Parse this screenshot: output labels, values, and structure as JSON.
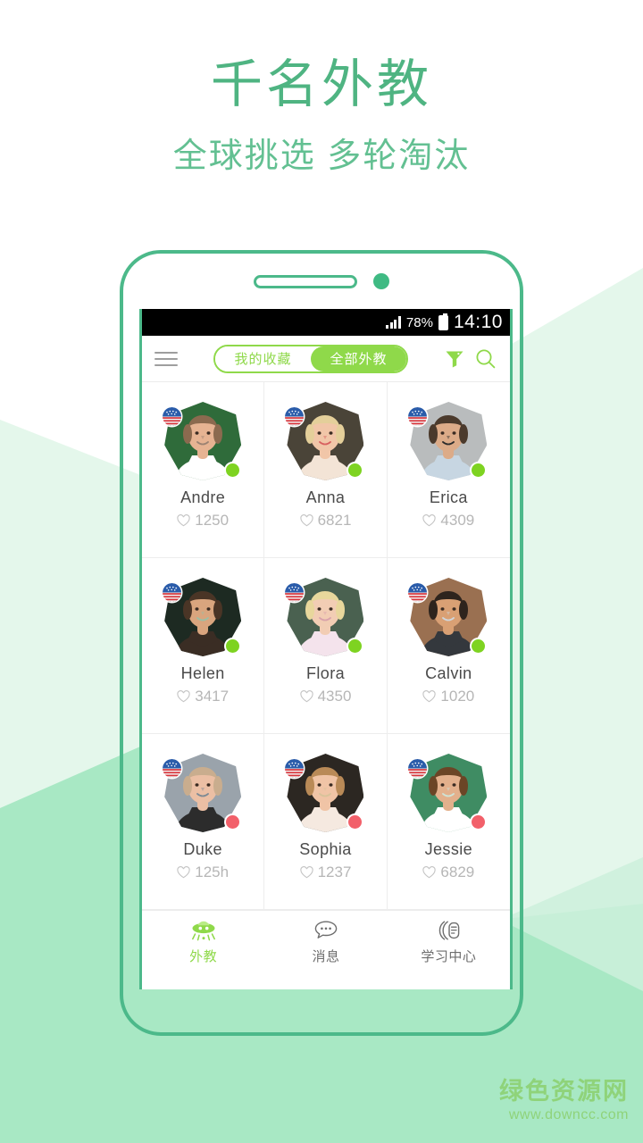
{
  "promo": {
    "title": "千名外教",
    "subtitle": "全球挑选 多轮淘汰",
    "title_color": "#4fb482",
    "subtitle_color": "#63c092"
  },
  "device": {
    "frame_color": "#4cb98a",
    "speaker": "speaker-slot",
    "camera": "front-camera",
    "home_button": "home-button"
  },
  "statusbar": {
    "signal": "signal-bars",
    "battery_percent": "78%",
    "battery": "battery-icon",
    "time": "14:10"
  },
  "appbar": {
    "menu": "hamburger-menu",
    "segment": {
      "left_label": "我的收藏",
      "right_label": "全部外教",
      "selected": "全部外教"
    },
    "filter": "filter-funnel-icon",
    "search": "search-icon",
    "accent": "#8fd94a"
  },
  "teachers": [
    {
      "name": "Andre",
      "likes": "1250",
      "status": "online",
      "flag": "us-flag",
      "bg": "#2f6b3a",
      "skin": "#e6b392",
      "hair": "#8b6a4f",
      "cloth": "#ffffff",
      "accent": "#9b8272"
    },
    {
      "name": "Anna",
      "likes": "6821",
      "status": "online",
      "flag": "us-flag",
      "bg": "#4a4438",
      "skin": "#f1c6a8",
      "hair": "#e4cf9a",
      "cloth": "#f3e4d6",
      "accent": "#d8605f"
    },
    {
      "name": "Erica",
      "likes": "4309",
      "status": "online",
      "flag": "us-flag",
      "bg": "#b9bcbd",
      "skin": "#dcab88",
      "hair": "#4b3a2c",
      "cloth": "#c7d6e2",
      "accent": "#2b2b2b"
    },
    {
      "name": "Helen",
      "likes": "3417",
      "status": "online",
      "flag": "us-flag",
      "bg": "#1d2a22",
      "skin": "#d9a57e",
      "hair": "#4a3526",
      "cloth": "#3a2d24",
      "accent": "#9bbfa5"
    },
    {
      "name": "Flora",
      "likes": "4350",
      "status": "online",
      "flag": "us-flag",
      "bg": "#4a6150",
      "skin": "#f2cdb4",
      "hair": "#e8d79c",
      "cloth": "#f4e3ec",
      "accent": "#d9a2ab"
    },
    {
      "name": "Calvin",
      "likes": "1020",
      "status": "online",
      "flag": "us-flag",
      "bg": "#9a7051",
      "skin": "#d9a074",
      "hair": "#2e241d",
      "cloth": "#34383d",
      "accent": "#cfd6dc"
    },
    {
      "name": "Duke",
      "likes": "125h",
      "status": "busy",
      "flag": "us-flag",
      "bg": "#9aa3ab",
      "skin": "#ebbfa4",
      "hair": "#c9ad8e",
      "cloth": "#2c2c2c",
      "accent": "#7d8a94"
    },
    {
      "name": "Sophia",
      "likes": "1237",
      "status": "busy",
      "flag": "us-flag",
      "bg": "#2c2722",
      "skin": "#f0c4a6",
      "hair": "#b98a57",
      "cloth": "#f5e9e0",
      "accent": "#d8c39a"
    },
    {
      "name": "Jessie",
      "likes": "6829",
      "status": "busy",
      "flag": "us-flag",
      "bg": "#3f8c63",
      "skin": "#e3b08c",
      "hair": "#6b4526",
      "cloth": "#ffffff",
      "accent": "#cfe3d6"
    }
  ],
  "tabbar": {
    "items": [
      {
        "label": "外教",
        "icon": "ufo-icon",
        "active": true
      },
      {
        "label": "消息",
        "icon": "chat-icon",
        "active": false
      },
      {
        "label": "学习中心",
        "icon": "document-icon",
        "active": false
      }
    ],
    "active_color": "#8fd94a",
    "inactive_color": "#6d6d6d"
  },
  "watermark": {
    "name": "绿色资源网",
    "url": "www.downcc.com",
    "color": "#8fd37a"
  },
  "background": {
    "base": "#ffffff",
    "band_light": "#e4f7eb",
    "band_mint": "#a8e8c4",
    "band_pale": "#cdf0dc"
  }
}
